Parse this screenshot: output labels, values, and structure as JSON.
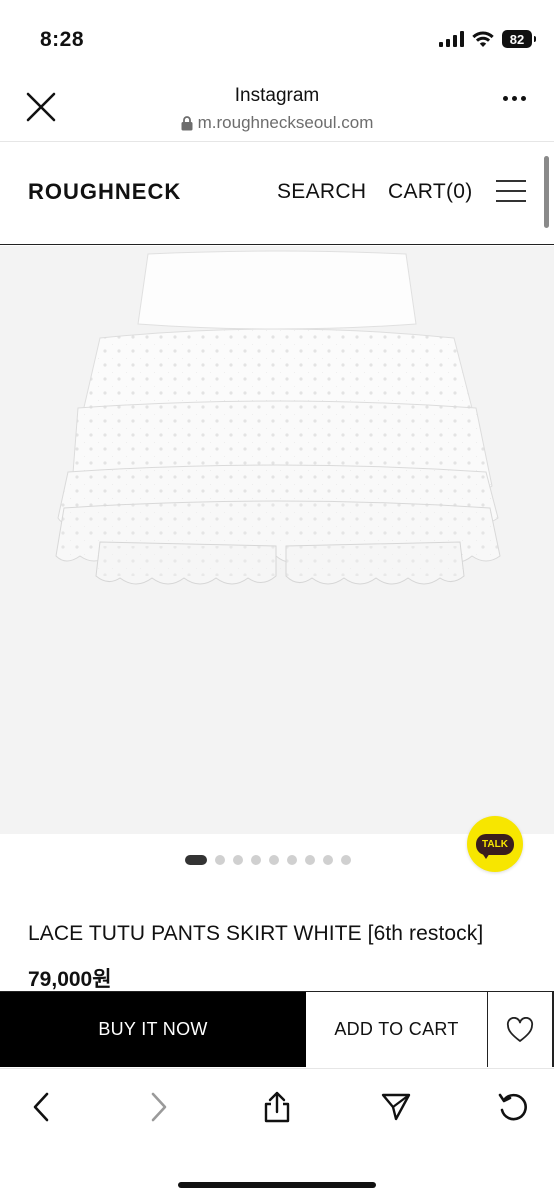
{
  "status_bar": {
    "time": "8:28",
    "battery": "82",
    "icons": [
      "signal-icon",
      "wifi-icon",
      "battery-icon"
    ]
  },
  "browser": {
    "title": "Instagram",
    "url": "m.roughneckseoul.com",
    "icons": [
      "close-icon",
      "lock-icon",
      "more-icon"
    ]
  },
  "site_header": {
    "logo": "ROUGHNECK",
    "search_label": "SEARCH",
    "cart_label": "CART(0)",
    "menu_icon": "hamburger-icon"
  },
  "product": {
    "image_alt": "lace-tutu-skirt",
    "carousel": {
      "total": 9,
      "active": 1
    },
    "name": "LACE TUTU PANTS SKIRT WHITE [6th restock]",
    "price": "79,000원"
  },
  "talk": {
    "label": "TALK",
    "color": "#f7e600"
  },
  "actions": {
    "buy_now": "BUY IT NOW",
    "add_to_cart": "ADD TO CART",
    "wishlist_icon": "heart-icon"
  },
  "toolbar": {
    "icons": [
      "back-icon",
      "forward-icon",
      "share-icon",
      "send-icon",
      "refresh-icon"
    ]
  }
}
